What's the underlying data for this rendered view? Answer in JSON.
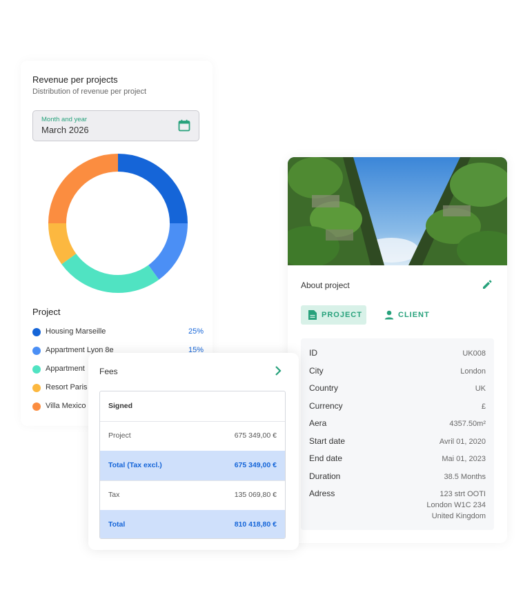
{
  "revenue": {
    "title": "Revenue per projects",
    "subtitle": "Distribution of revenue per project",
    "picker": {
      "label": "Month and year",
      "value": "March 2026",
      "icon": "calendar-icon"
    },
    "project_heading": "Project",
    "legend": [
      {
        "name": "Housing Marseille",
        "pct": "25%",
        "color": "#1565d8"
      },
      {
        "name": "Appartment Lyon 8e",
        "pct": "15%",
        "color": "#4b8ff5"
      },
      {
        "name": "Appartment",
        "pct": "",
        "color": "#50e3c2"
      },
      {
        "name": "Resort Paris",
        "pct": "",
        "color": "#fcb840"
      },
      {
        "name": "Villa Mexico",
        "pct": "",
        "color": "#fb8d40"
      }
    ]
  },
  "chart_data": {
    "type": "pie",
    "style": "donut",
    "categories": [
      "Housing Marseille",
      "Appartment Lyon 8e",
      "Appartment",
      "Resort Paris",
      "Villa Mexico"
    ],
    "values": [
      25,
      15,
      25,
      10,
      25
    ],
    "colors": [
      "#1565d8",
      "#4b8ff5",
      "#50e3c2",
      "#fcb840",
      "#fb8d40"
    ]
  },
  "fees": {
    "title": "Fees",
    "chevron_icon": "chevron-right-icon",
    "header": "Signed",
    "rows": [
      {
        "label": "Project",
        "value": "675 349,00 €",
        "highlight": false
      },
      {
        "label": "Total (Tax excl.)",
        "value": "675 349,00 €",
        "highlight": true
      },
      {
        "label": "Tax",
        "value": "135 069,80 €",
        "highlight": false
      },
      {
        "label": "Total",
        "value": "810 418,80 €",
        "highlight": true
      }
    ]
  },
  "project": {
    "about": "About project",
    "edit_icon": "pencil-icon",
    "tabs": [
      {
        "label": "PROJECT",
        "icon": "document-icon",
        "active": true
      },
      {
        "label": "CLIENT",
        "icon": "person-icon",
        "active": false
      }
    ],
    "info": [
      {
        "key": "ID",
        "value": "UK008"
      },
      {
        "key": "City",
        "value": "London"
      },
      {
        "key": "Country",
        "value": "UK"
      },
      {
        "key": "Currency",
        "value": "£"
      },
      {
        "key": "Aera",
        "value": "4357.50m²"
      },
      {
        "key": "Start date",
        "value": "Avril 01, 2020"
      },
      {
        "key": "End date",
        "value": "Mai 01, 2023"
      },
      {
        "key": "Duration",
        "value": "38.5 Months"
      },
      {
        "key": "Adress",
        "value": "123 strt OOTI\nLondon W1C 234\nUnited Kingdom"
      }
    ]
  },
  "colors": {
    "accent_green": "#26a17b",
    "accent_blue": "#1565d8",
    "highlight_blue": "#cfe0fb"
  }
}
